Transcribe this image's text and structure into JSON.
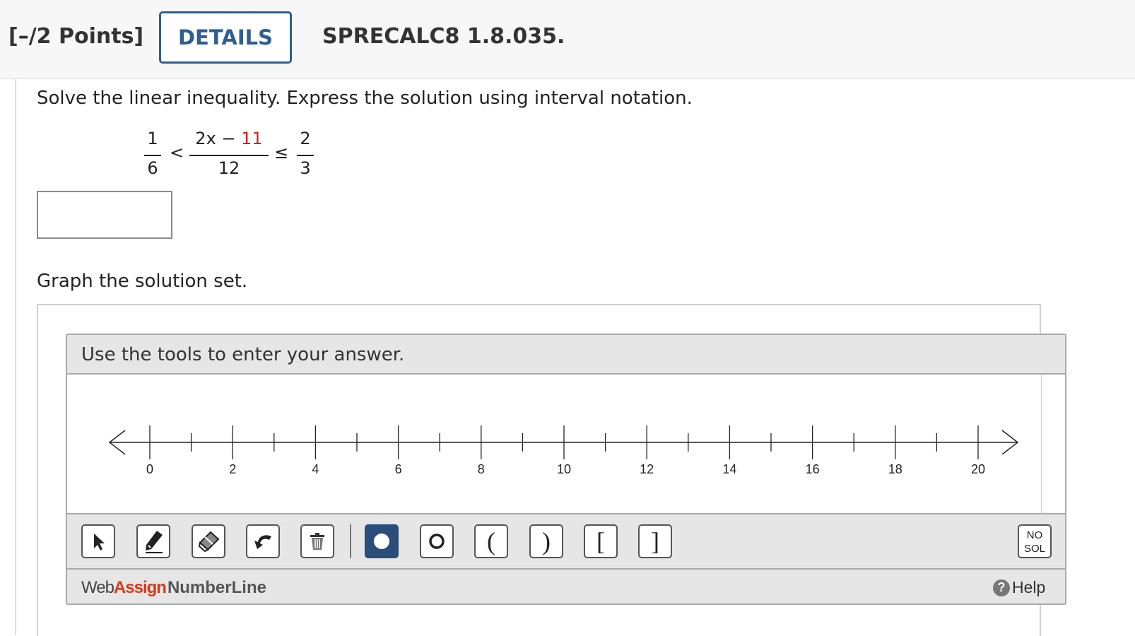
{
  "header": {
    "points": "[–/2 Points]",
    "details_label": "DETAILS",
    "problem_code": "SPRECALC8 1.8.035."
  },
  "question": {
    "prompt": "Solve the linear inequality. Express the solution using interval notation.",
    "inequality": {
      "left_num": "1",
      "left_den": "6",
      "rel1": "<",
      "mid_num_a": "2x − ",
      "mid_num_b": "11",
      "mid_den": "12",
      "rel2": "≤",
      "right_num": "2",
      "right_den": "3"
    },
    "answer_value": "",
    "graph_prompt": "Graph the solution set."
  },
  "tool": {
    "instruction": "Use the tools to enter your answer.",
    "axis": {
      "min": 0,
      "max": 20,
      "minor_step": 1,
      "label_step": 2,
      "labels": [
        "0",
        "2",
        "4",
        "6",
        "8",
        "10",
        "12",
        "14",
        "16",
        "18",
        "20"
      ]
    },
    "buttons": [
      {
        "name": "pointer-tool-button",
        "icon": "arrow-icon"
      },
      {
        "name": "pencil-tool-button",
        "icon": "pencil-icon"
      },
      {
        "name": "eraser-tool-button",
        "icon": "eraser-icon"
      },
      {
        "name": "undo-button",
        "icon": "undo-icon"
      },
      {
        "name": "delete-button",
        "icon": "trash-icon"
      },
      {
        "name": "closed-point-button",
        "icon": "filled-dot-icon",
        "active": true
      },
      {
        "name": "open-point-button",
        "icon": "open-dot-icon"
      },
      {
        "name": "left-paren-button",
        "text": "("
      },
      {
        "name": "right-paren-button",
        "text": ")"
      },
      {
        "name": "left-bracket-button",
        "text": "["
      },
      {
        "name": "right-bracket-button",
        "text": "]"
      }
    ],
    "no_solution_label_1": "NO",
    "no_solution_label_2": "SOL",
    "brand_web": "Web",
    "brand_assign": "Assign",
    "brand_product": "NumberLine",
    "help_label": "Help",
    "accent_color": "#2a4d7a"
  }
}
